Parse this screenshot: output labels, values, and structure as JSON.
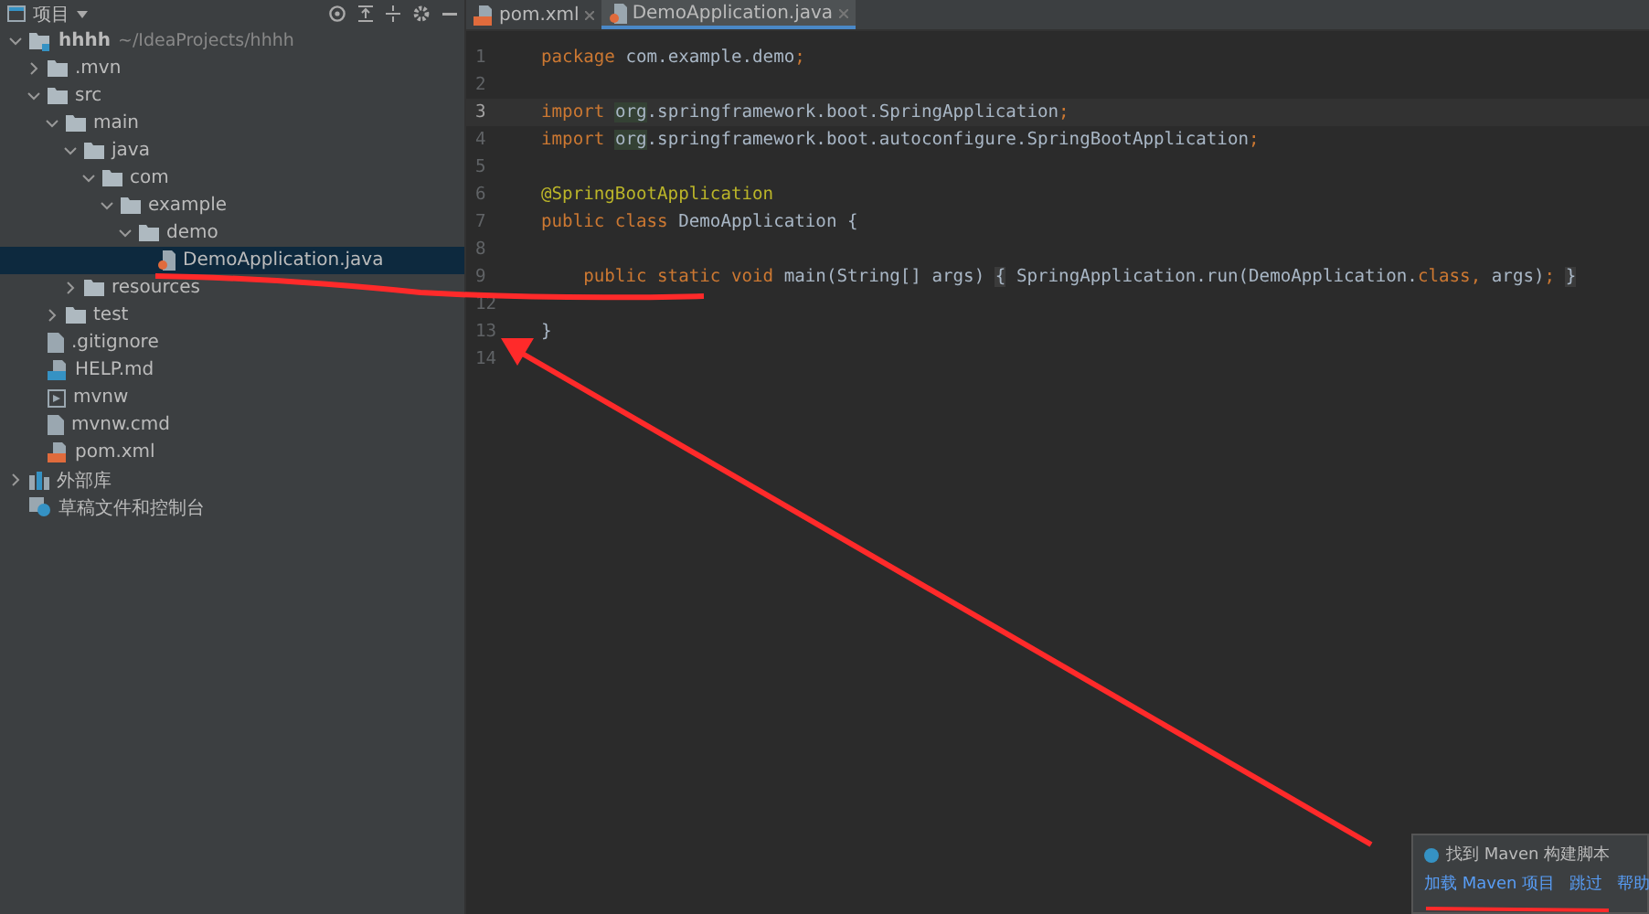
{
  "project_panel": {
    "title": "项目",
    "tree": [
      {
        "label": "hhhh",
        "hint": "~/IdeaProjects/hhhh",
        "kind": "module",
        "expanded": true,
        "selected": false,
        "children": [
          {
            "label": ".mvn",
            "kind": "folder",
            "expanded": false,
            "selected": false
          },
          {
            "label": "src",
            "kind": "folder",
            "expanded": true,
            "selected": false,
            "children": [
              {
                "label": "main",
                "kind": "folder",
                "expanded": true,
                "selected": false,
                "children": [
                  {
                    "label": "java",
                    "kind": "folder",
                    "expanded": true,
                    "selected": false,
                    "children": [
                      {
                        "label": "com",
                        "kind": "folder",
                        "expanded": true,
                        "selected": false,
                        "children": [
                          {
                            "label": "example",
                            "kind": "folder",
                            "expanded": true,
                            "selected": false,
                            "children": [
                              {
                                "label": "demo",
                                "kind": "folder",
                                "expanded": true,
                                "selected": false,
                                "children": [
                                  {
                                    "label": "DemoApplication.java",
                                    "kind": "java",
                                    "selected": true
                                  }
                                ]
                              }
                            ]
                          }
                        ]
                      }
                    ]
                  },
                  {
                    "label": "resources",
                    "kind": "folder",
                    "expanded": false,
                    "selected": false
                  }
                ]
              },
              {
                "label": "test",
                "kind": "folder",
                "expanded": false,
                "selected": false
              }
            ]
          },
          {
            "label": ".gitignore",
            "kind": "file",
            "selected": false
          },
          {
            "label": "HELP.md",
            "kind": "md",
            "selected": false
          },
          {
            "label": "mvnw",
            "kind": "script",
            "selected": false
          },
          {
            "label": "mvnw.cmd",
            "kind": "file",
            "selected": false
          },
          {
            "label": "pom.xml",
            "kind": "maven",
            "selected": false
          }
        ]
      },
      {
        "label": "外部库",
        "kind": "library",
        "expanded": false,
        "selected": false
      },
      {
        "label": "草稿文件和控制台",
        "kind": "scratch",
        "selected": false
      }
    ]
  },
  "editor": {
    "tabs": [
      {
        "label": "pom.xml",
        "kind": "maven",
        "selected": false
      },
      {
        "label": "DemoApplication.java",
        "kind": "java",
        "selected": true
      }
    ],
    "lines": [
      {
        "number": "1",
        "current": false,
        "tokens": [
          {
            "text": "package ",
            "kind": "keyword"
          },
          {
            "text": "com.example.demo",
            "kind": "plain"
          },
          {
            "text": ";",
            "kind": "keyword"
          }
        ]
      },
      {
        "number": "2",
        "current": false
      },
      {
        "number": "3",
        "current": true,
        "tokens": [
          {
            "text": "import ",
            "kind": "keyword"
          },
          {
            "text": "org",
            "kind": "marked"
          },
          {
            "text": ".springframework.boot.SpringApplication",
            "kind": "plain"
          },
          {
            "text": ";",
            "kind": "keyword"
          }
        ]
      },
      {
        "number": "4",
        "current": false,
        "tokens": [
          {
            "text": "import ",
            "kind": "keyword"
          },
          {
            "text": "org",
            "kind": "marked"
          },
          {
            "text": ".springframework.boot.autoconfigure.SpringBootApplication",
            "kind": "plain"
          },
          {
            "text": ";",
            "kind": "keyword"
          }
        ]
      },
      {
        "number": "5",
        "current": false
      },
      {
        "number": "6",
        "current": false,
        "tokens": [
          {
            "text": "@SpringBootApplication",
            "kind": "annotation"
          }
        ]
      },
      {
        "number": "7",
        "current": false,
        "tokens": [
          {
            "text": "public class ",
            "kind": "keyword"
          },
          {
            "text": "DemoApplication {",
            "kind": "plain"
          }
        ]
      },
      {
        "number": "8",
        "current": false
      },
      {
        "number": "9",
        "current": false,
        "tokens": [
          {
            "text": "    public static void ",
            "kind": "keyword"
          },
          {
            "text": "main(String[] args) ",
            "kind": "plain"
          },
          {
            "text": "{",
            "kind": "fold"
          },
          {
            "text": " SpringApplication.run(DemoApplication.",
            "kind": "plain"
          },
          {
            "text": "class",
            "kind": "keyword"
          },
          {
            "text": ", ",
            "kind": "keyword"
          },
          {
            "text": "args)",
            "kind": "plain"
          },
          {
            "text": "; ",
            "kind": "keyword"
          },
          {
            "text": "}",
            "kind": "fold"
          }
        ]
      },
      {
        "number": "12",
        "current": false
      },
      {
        "number": "13",
        "current": false,
        "tokens": [
          {
            "text": "}",
            "kind": "plain"
          }
        ]
      },
      {
        "number": "14",
        "current": false
      }
    ]
  },
  "notification": {
    "message": "找到 Maven 构建脚本",
    "actions": [
      "加载 Maven 项目",
      "跳过",
      "帮助"
    ]
  }
}
